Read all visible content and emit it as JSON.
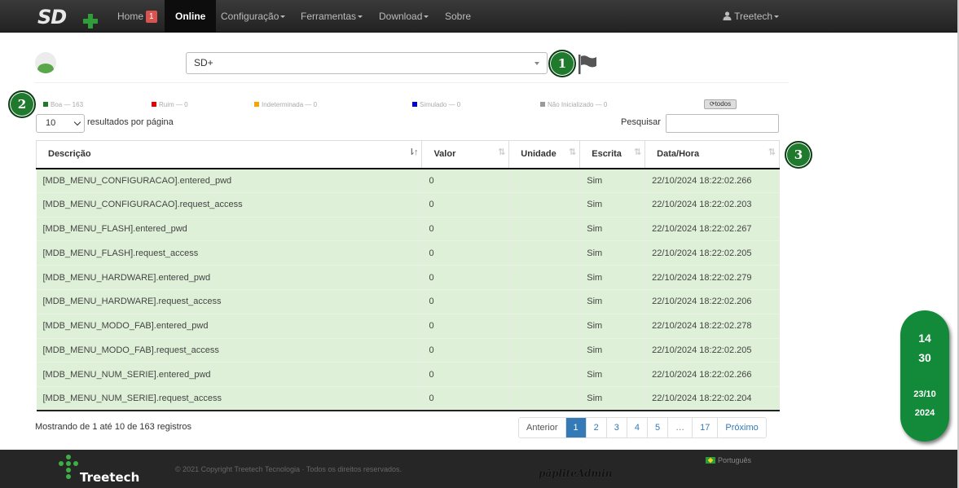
{
  "navbar": {
    "logo_text": "SD+",
    "items": [
      {
        "label": "Home",
        "badge": "1"
      },
      {
        "label": "Online"
      },
      {
        "label": "Configuração"
      },
      {
        "label": "Ferramentas"
      },
      {
        "label": "Download"
      },
      {
        "label": "Sobre"
      }
    ],
    "user": "Treetech"
  },
  "device_select": {
    "value": "SD+"
  },
  "markers": [
    "1",
    "2",
    "3"
  ],
  "legend": {
    "items": [
      {
        "label": "Boa — 163",
        "color": "#1f7a2e"
      },
      {
        "label": "Ruim — 0",
        "color": "#e00000"
      },
      {
        "label": "Indeterminada — 0",
        "color": "#f5a400"
      },
      {
        "label": "Simulado — 0",
        "color": "#0000cc"
      },
      {
        "label": "Não Inicializado — 0",
        "color": "#9a9a9a"
      }
    ],
    "todos_label": "todos"
  },
  "controls": {
    "page_length": "10",
    "length_label": "resultados por página",
    "search_label": "Pesquisar",
    "search_value": ""
  },
  "table": {
    "columns": [
      "Descrição",
      "Valor",
      "Unidade",
      "Escrita",
      "Data/Hora"
    ],
    "rows": [
      [
        "[MDB_MENU_CONFIGURACAO].entered_pwd",
        "0",
        "",
        "Sim",
        "22/10/2024 18:22:02.266"
      ],
      [
        "[MDB_MENU_CONFIGURACAO].request_access",
        "0",
        "",
        "Sim",
        "22/10/2024 18:22:02.203"
      ],
      [
        "[MDB_MENU_FLASH].entered_pwd",
        "0",
        "",
        "Sim",
        "22/10/2024 18:22:02.267"
      ],
      [
        "[MDB_MENU_FLASH].request_access",
        "0",
        "",
        "Sim",
        "22/10/2024 18:22:02.205"
      ],
      [
        "[MDB_MENU_HARDWARE].entered_pwd",
        "0",
        "",
        "Sim",
        "22/10/2024 18:22:02.279"
      ],
      [
        "[MDB_MENU_HARDWARE].request_access",
        "0",
        "",
        "Sim",
        "22/10/2024 18:22:02.206"
      ],
      [
        "[MDB_MENU_MODO_FAB].entered_pwd",
        "0",
        "",
        "Sim",
        "22/10/2024 18:22:02.278"
      ],
      [
        "[MDB_MENU_MODO_FAB].request_access",
        "0",
        "",
        "Sim",
        "22/10/2024 18:22:02.205"
      ],
      [
        "[MDB_MENU_NUM_SERIE].entered_pwd",
        "0",
        "",
        "Sim",
        "22/10/2024 18:22:02.266"
      ],
      [
        "[MDB_MENU_NUM_SERIE].request_access",
        "0",
        "",
        "Sim",
        "22/10/2024 18:22:02.204"
      ]
    ]
  },
  "info": "Mostrando de 1 até 10 de 163 registros",
  "pagination": {
    "prev": "Anterior",
    "pages": [
      "1",
      "2",
      "3",
      "4",
      "5",
      "…",
      "17"
    ],
    "current": "1",
    "next": "Próximo"
  },
  "clock": {
    "hour": "14",
    "minute": "30",
    "day_month": "23/10",
    "year": "2024"
  },
  "footer": {
    "brand": "Treetech",
    "copyright": "© 2021 Copyright Treetech Tecnologia · Todos os direitos reservados.",
    "product": "păpliteAdmin",
    "language": "Português"
  },
  "colors": {
    "row_good": "#dff0d8",
    "accent": "#337ab7",
    "clock": "#128a3a"
  }
}
